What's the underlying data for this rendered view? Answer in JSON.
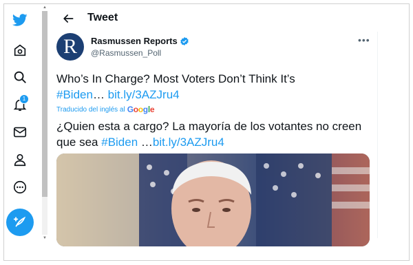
{
  "sidebar": {
    "items": [
      {
        "icon": "twitter-bird-icon"
      },
      {
        "icon": "home-icon"
      },
      {
        "icon": "search-icon"
      },
      {
        "icon": "notifications-bell-icon",
        "badge": "1"
      },
      {
        "icon": "messages-mail-icon"
      },
      {
        "icon": "profile-icon"
      },
      {
        "icon": "more-icon"
      }
    ],
    "compose_icon": "compose-tweet-icon"
  },
  "header": {
    "title": "Tweet",
    "back_icon": "back-arrow-icon"
  },
  "tweet": {
    "author_name": "Rasmussen Reports",
    "avatar_letter": "R",
    "handle": "@Rasmussen_Poll",
    "more_label": "•••",
    "text_main": "Who’s In Charge? Most Voters Don’t Think It’s",
    "hashtag": "#Biden",
    "ellipsis": "…",
    "link": "bit.ly/3AZJru4",
    "translated_label": "Traducido del inglés al",
    "translator_brand": "Google",
    "translation_text": "¿Quien esta a cargo? La mayoría de los votantes no creen que sea",
    "translation_hashtag": "#Biden",
    "translation_ellipsis": " …",
    "translation_link": "bit.ly/3AZJru4"
  },
  "colors": {
    "accent": "#1d9bf0",
    "text": "#0f1419",
    "secondary": "#536471",
    "avatar_bg": "#1c3f73"
  }
}
